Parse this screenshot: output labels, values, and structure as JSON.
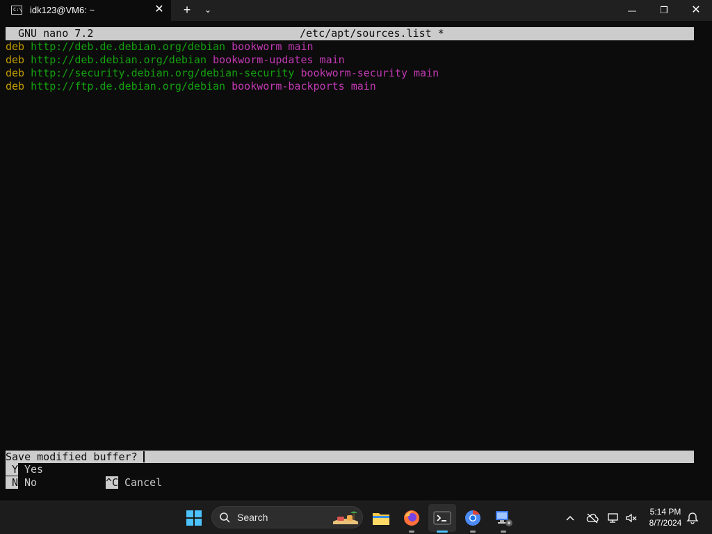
{
  "window": {
    "tab_title": "idk123@VM6: ~",
    "tab_icon_text": "C:\\",
    "close_tab_glyph": "✕",
    "new_tab_glyph": "+",
    "dropdown_glyph": "⌄",
    "minimize_glyph": "—",
    "maximize_glyph": "❐",
    "close_glyph": "✕"
  },
  "nano": {
    "version": "GNU nano 7.2",
    "filename": "/etc/apt/sources.list *",
    "lines": [
      {
        "kw": "deb",
        "url": "http://deb.de.debian.org/debian",
        "suite": "bookworm main"
      },
      {
        "kw": "deb",
        "url": "http://deb.debian.org/debian",
        "suite": "bookworm-updates main"
      },
      {
        "kw": "deb",
        "url": "http://security.debian.org/debian-security",
        "suite": "bookworm-security main"
      },
      {
        "kw": "deb",
        "url": "http://ftp.de.debian.org/debian",
        "suite": "bookworm-backports main"
      }
    ],
    "prompt": "Save modified buffer?",
    "options": [
      {
        "key": "Y",
        "label": "Yes"
      },
      {
        "key": "N",
        "label": "No"
      },
      {
        "key": "^C",
        "label": "Cancel"
      }
    ]
  },
  "taskbar": {
    "search_placeholder": "Search",
    "time": "5:14 PM",
    "date": "8/7/2024"
  },
  "colors": {
    "keyword": "#c19c00",
    "url": "#13a10e",
    "suite": "#c239b3",
    "accent": "#4cc2ff"
  }
}
